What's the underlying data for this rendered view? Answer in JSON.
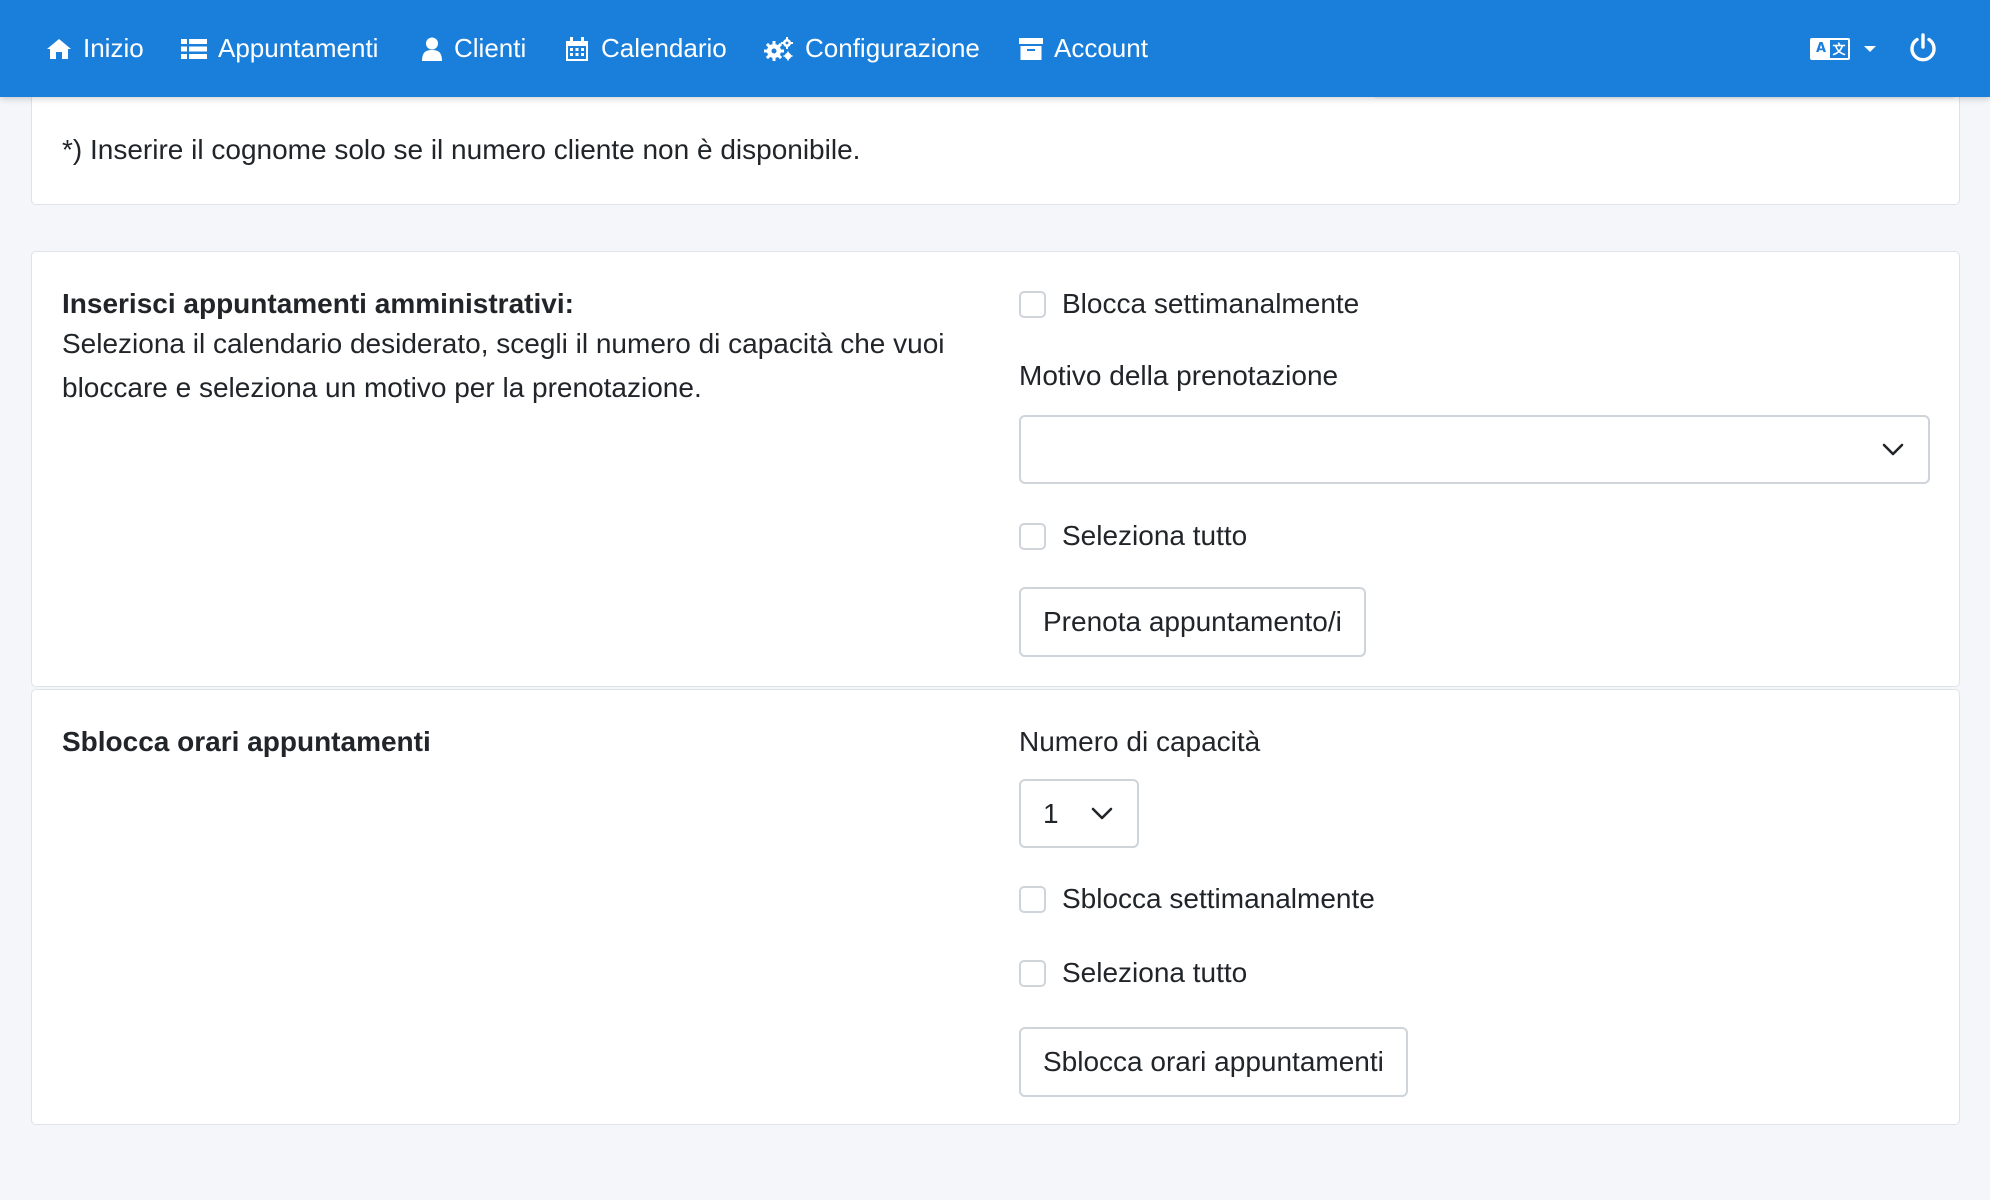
{
  "navbar": {
    "items": [
      {
        "label": "Inizio",
        "icon": "home-icon"
      },
      {
        "label": "Appuntamenti",
        "icon": "list-icon"
      },
      {
        "label": "Clienti",
        "icon": "user-icon"
      },
      {
        "label": "Calendario",
        "icon": "calendar-icon"
      },
      {
        "label": "Configurazione",
        "icon": "gears-icon"
      },
      {
        "label": "Account",
        "icon": "archive-icon"
      }
    ],
    "language_icon": "language-icon",
    "logout_icon": "power-icon",
    "color": "#1a7fdb"
  },
  "customer_note": "*) Inserire il cognome solo se il numero cliente non è disponibile.",
  "admin_section": {
    "title": "Inserisci appuntamenti amministrativi:",
    "description": "Seleziona il calendario desiderato, scegli il numero di capacità che vuoi bloccare e seleziona un motivo per la prenotazione.",
    "block_weekly_label": "Blocca settimanalmente",
    "booking_reason_label": "Motivo della prenotazione",
    "booking_reason_value": "",
    "select_all_label": "Seleziona tutto",
    "book_button": "Prenota appuntamento/i"
  },
  "unlock_section": {
    "title": "Sblocca orari appuntamenti",
    "capacity_label": "Numero di capacità",
    "capacity_value": "1",
    "unlock_weekly_label": "Sblocca settimanalmente",
    "select_all_label": "Seleziona tutto",
    "unlock_button": "Sblocca orari appuntamenti"
  }
}
